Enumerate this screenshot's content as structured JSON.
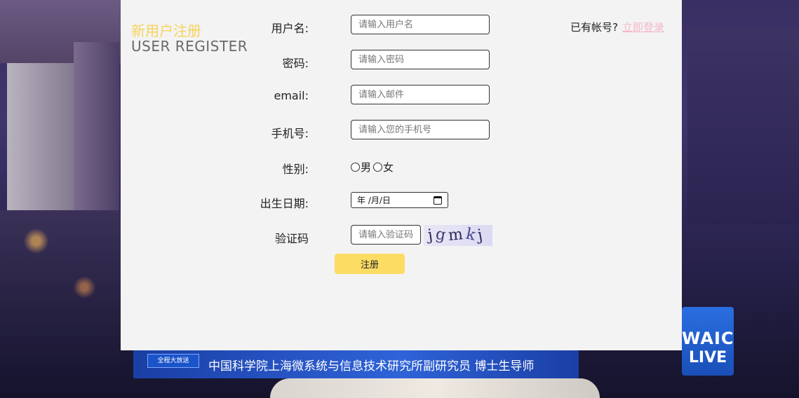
{
  "background": {
    "banner_tag": "全程大放送",
    "banner_text": "中国科学院上海微系统与信息技术研究所副研究员 博士生导师",
    "logo_line1": "WAIC",
    "logo_line2": "LIVE"
  },
  "header": {
    "title_cn": "新用户注册",
    "title_en": "USER REGISTER",
    "has_account_text": "已有帐号?",
    "login_link": "立即登录"
  },
  "form": {
    "username": {
      "label": "用户名:",
      "placeholder": "请输入用户名"
    },
    "password": {
      "label": "密码:",
      "placeholder": "请输入密码"
    },
    "email": {
      "label": "email:",
      "placeholder": "请输入邮件"
    },
    "phone": {
      "label": "手机号:",
      "placeholder": "请输入您的手机号"
    },
    "gender": {
      "label": "性别:",
      "options": [
        "男",
        "女"
      ]
    },
    "birthday": {
      "label": "出生日期:",
      "value": "年 /月/日"
    },
    "captcha": {
      "label": "验证码",
      "placeholder": "请输入验证码",
      "image_text": [
        "j",
        "g",
        "m",
        "k",
        "j"
      ]
    },
    "submit_label": "注册"
  },
  "colors": {
    "title_cn": "#f7d35a",
    "submit_bg": "#fcdc63",
    "login_link": "#f5b7c9",
    "panel_bg": "#f3f3f3"
  }
}
